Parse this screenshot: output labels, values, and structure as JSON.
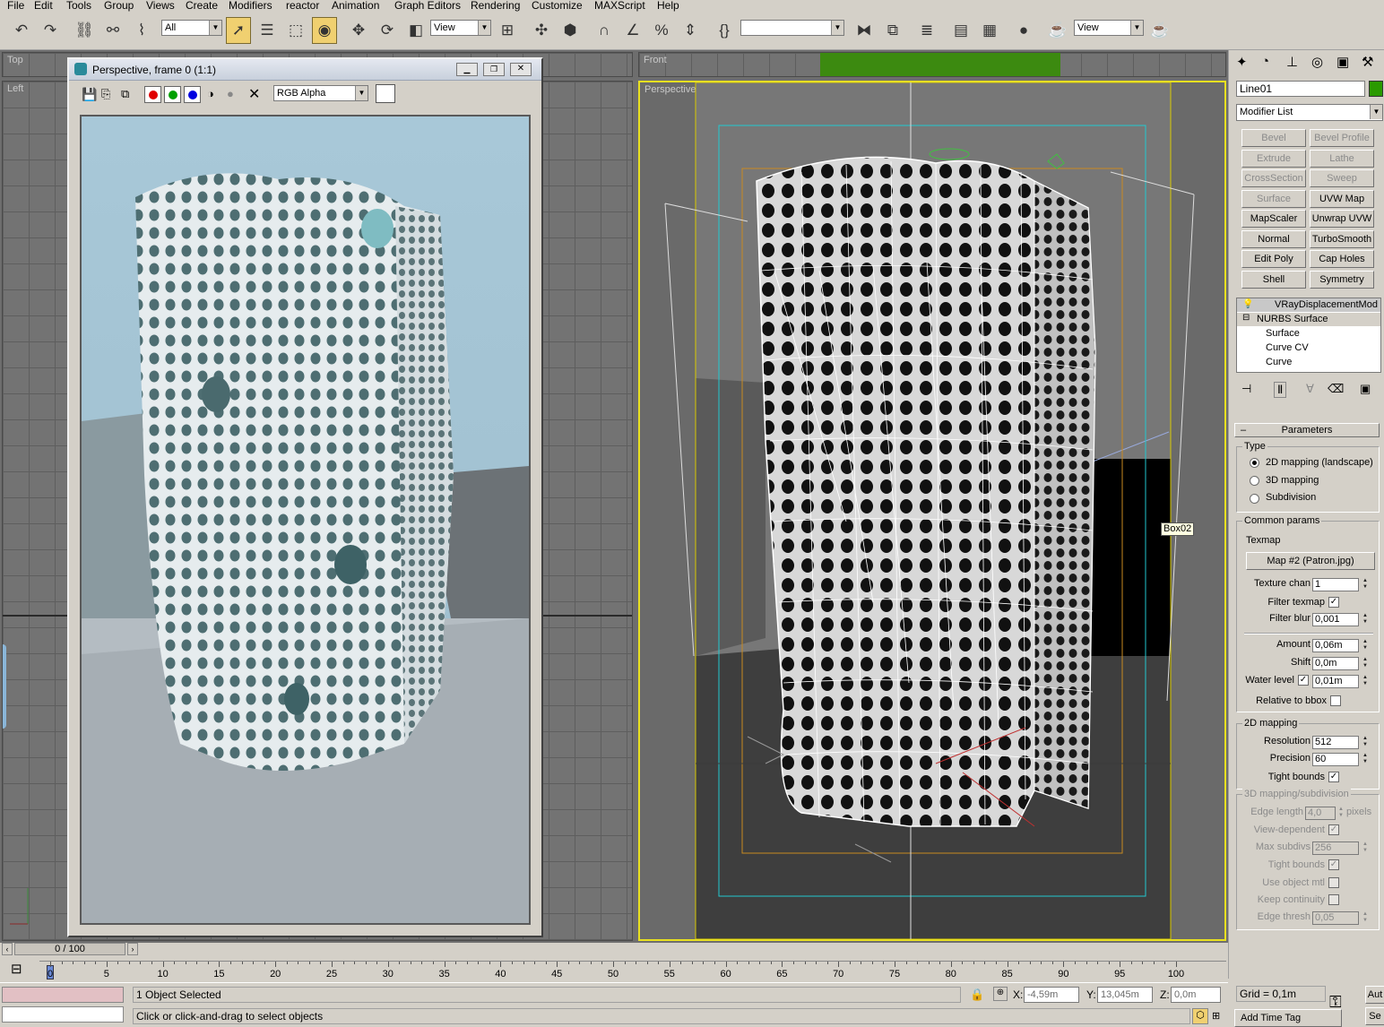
{
  "menu": [
    "File",
    "Edit",
    "Tools",
    "Group",
    "Views",
    "Create",
    "Modifiers",
    "reactor",
    "Animation",
    "Graph Editors",
    "Rendering",
    "Customize",
    "MAXScript",
    "Help"
  ],
  "toolbar": {
    "selection_filter": "All",
    "ref_coord": "View",
    "ref_coord2": "View",
    "named_sel": ""
  },
  "viewports": {
    "top_label": "Top",
    "front_label": "Front",
    "left_label": "Left",
    "perspective_label": "Perspective",
    "tooltip": "Box02"
  },
  "render_window": {
    "title": "Perspective, frame 0 (1:1)",
    "channel": "RGB Alpha"
  },
  "cmd": {
    "object_name": "Line01",
    "object_color": "#2a9a00",
    "modifier_list": "Modifier List",
    "buttons": [
      {
        "label": "Bevel",
        "enabled": false
      },
      {
        "label": "Bevel Profile",
        "enabled": false
      },
      {
        "label": "Extrude",
        "enabled": false
      },
      {
        "label": "Lathe",
        "enabled": false
      },
      {
        "label": "CrossSection",
        "enabled": false
      },
      {
        "label": "Sweep",
        "enabled": false
      },
      {
        "label": "Surface",
        "enabled": false
      },
      {
        "label": "UVW Map",
        "enabled": true
      },
      {
        "label": "MapScaler",
        "enabled": true
      },
      {
        "label": "Unwrap UVW",
        "enabled": true
      },
      {
        "label": "Normal",
        "enabled": true
      },
      {
        "label": "TurboSmooth",
        "enabled": true
      },
      {
        "label": "Edit Poly",
        "enabled": true
      },
      {
        "label": "Cap Holes",
        "enabled": true
      },
      {
        "label": "Shell",
        "enabled": true
      },
      {
        "label": "Symmetry",
        "enabled": true
      }
    ],
    "stack": {
      "top": "VRayDisplacementMod",
      "nurbs": "NURBS Surface",
      "children": [
        "Surface",
        "Curve CV",
        "Curve"
      ]
    },
    "rollout_title": "Parameters",
    "type_group": "Type",
    "type_options": [
      "2D mapping (landscape)",
      "3D mapping",
      "Subdivision"
    ],
    "common_group": "Common params",
    "texmap_label": "Texmap",
    "texmap_button": "Map #2 (Patron.jpg)",
    "texture_chan_label": "Texture chan",
    "texture_chan": "1",
    "filter_texmap_label": "Filter texmap",
    "filter_blur_label": "Filter blur",
    "filter_blur": "0,001",
    "amount_label": "Amount",
    "amount": "0,06m",
    "shift_label": "Shift",
    "shift": "0,0m",
    "water_label": "Water level",
    "water": "0,01m",
    "rel_bbox_label": "Relative to bbox",
    "mapping2d_group": "2D mapping",
    "resolution_label": "Resolution",
    "resolution": "512",
    "precision_label": "Precision",
    "precision": "60",
    "tight_bounds_label": "Tight bounds",
    "mapping3d_group": "3D mapping/subdivision",
    "edge_length_label": "Edge length",
    "edge_length": "4,0",
    "pixels_label": "pixels",
    "view_dep_label": "View-dependent",
    "max_subdivs_label": "Max subdivs",
    "max_subdivs": "256",
    "tight_bounds2_label": "Tight bounds",
    "use_obj_mtl_label": "Use object mtl",
    "keep_cont_label": "Keep continuity",
    "edge_thresh_label": "Edge thresh",
    "edge_thresh": "0,05"
  },
  "timeline": {
    "frame": "0 / 100",
    "progress": 0.0,
    "ticks": [
      "0",
      "5",
      "10",
      "15",
      "20",
      "25",
      "30",
      "35",
      "40",
      "45",
      "50",
      "55",
      "60",
      "65",
      "70",
      "75",
      "80",
      "85",
      "90",
      "95",
      "100"
    ]
  },
  "status": {
    "selected": "1 Object Selected",
    "prompt": "Click or click-and-drag to select objects",
    "x_label": "X:",
    "x": "-4,59m",
    "y_label": "Y:",
    "y": "13,045m",
    "z_label": "Z:",
    "z": "0,0m",
    "grid": "Grid = 0,1m",
    "add_time_tag": "Add Time Tag",
    "auto_key": "Aut",
    "set_key": "Se"
  }
}
